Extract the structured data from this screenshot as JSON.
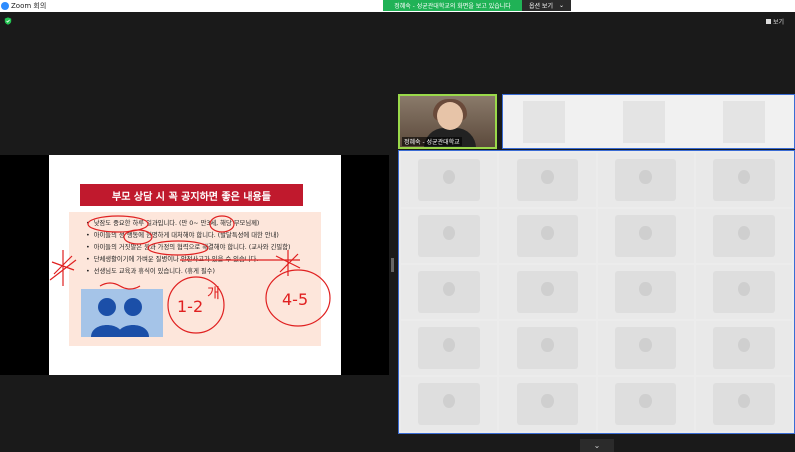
{
  "app": {
    "title": "Zoom 회의"
  },
  "banner": {
    "sharing_text": "정혜숙 - 성균관대학교의 화면을 보고 있습니다",
    "view_options_label": "옵션 보기"
  },
  "toolbar": {
    "view_label": "보기"
  },
  "slide": {
    "title": "부모 상담 시  꼭 공지하면 좋은 내용들",
    "bullets": [
      "낮잠도 중요한 하루 일과입니다. (만 0~ 만3세, 해당 부모님께)",
      "아이들의 성 행동에 현명하게 대처해야 합니다. (발달특성에 대한 안내)",
      "아이들의 거짓말은 원과 가정의 협력으로 해결해야 합니다. (교사와 긴밀함)",
      "단체생활이기에 가벼운 질병이나 안전사고가 있을 수 있습니다.",
      "선생님도 교육과 휴식이 있습니다. (휴게 필수)"
    ]
  },
  "annotations": {
    "label_1": "1-2",
    "label_2": "4-5",
    "unit": "개"
  },
  "speaker": {
    "name": "정혜숙 - 성균관대학교"
  },
  "colors": {
    "banner_green": "#20b256",
    "slide_red": "#c0192d",
    "ink_red": "#e02020",
    "speaker_border": "#9ad94a",
    "gallery_border": "#3a6cd4"
  },
  "icons": {
    "app": "zoom-logo-icon",
    "security": "shield-icon",
    "view": "grid-icon",
    "options": "chevron-down-icon",
    "gallery_nav": "chevron-down-icon"
  }
}
